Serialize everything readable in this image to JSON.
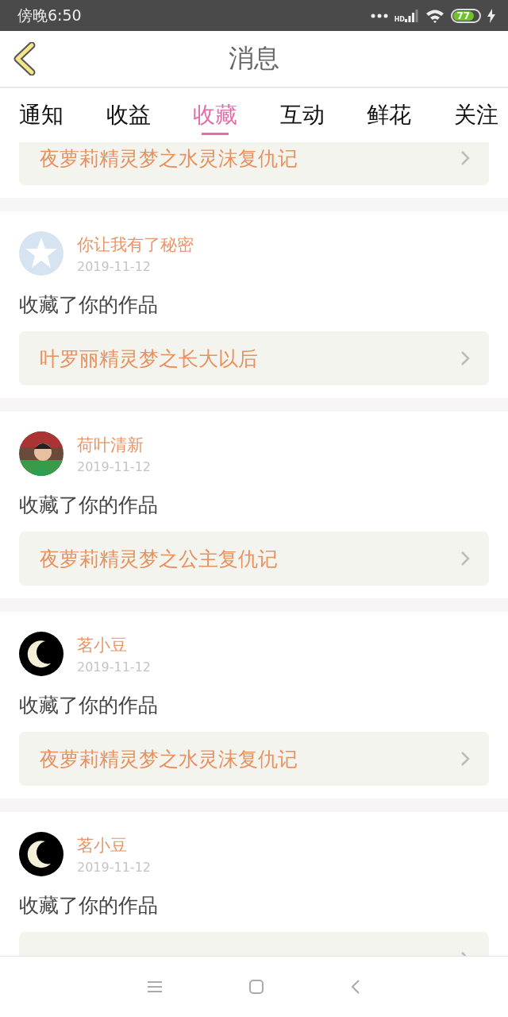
{
  "status_bar": {
    "time": "傍晚6:50",
    "network": "HD",
    "battery": "77",
    "charging": true
  },
  "header": {
    "title": "消息"
  },
  "tabs": [
    {
      "label": "通知",
      "selected": false
    },
    {
      "label": "收益",
      "selected": false
    },
    {
      "label": "收藏",
      "selected": true
    },
    {
      "label": "互动",
      "selected": false
    },
    {
      "label": "鲜花",
      "selected": false
    },
    {
      "label": "关注",
      "selected": false
    }
  ],
  "items": [
    {
      "kind": "cut",
      "work": "夜萝莉精灵梦之水灵沫复仇记"
    },
    {
      "kind": "full",
      "avatar": {
        "kind": "star"
      },
      "name": "你让我有了秘密",
      "date": "2019-11-12",
      "action": "收藏了你的作品",
      "work": "叶罗丽精灵梦之长大以后"
    },
    {
      "kind": "full",
      "name": "荷叶清新",
      "date": "2019-11-12",
      "action": "收藏了你的作品",
      "work": "夜萝莉精灵梦之公主复仇记"
    },
    {
      "kind": "full",
      "avatar": {
        "kind": "moon"
      },
      "name": "茗小豆",
      "date": "2019-11-12",
      "action": "收藏了你的作品",
      "work": "夜萝莉精灵梦之水灵沫复仇记"
    },
    {
      "kind": "full",
      "avatar": {
        "kind": "moon"
      },
      "name": "茗小豆",
      "date": "2019-11-12",
      "action": "收藏了你的作品"
    }
  ]
}
